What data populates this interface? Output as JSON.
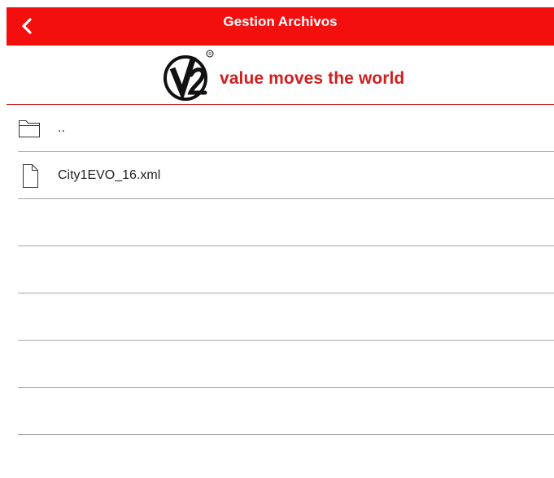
{
  "header": {
    "title": "Gestion Archivos",
    "back_icon": "chevron-left-icon",
    "background": "#f40f0f"
  },
  "brand": {
    "logo_text": "V2",
    "registered_mark": "®",
    "tagline": "value moves the world",
    "color": "#d01f1f"
  },
  "files": [
    {
      "name": "..",
      "type": "folder",
      "icon": "folder-icon"
    },
    {
      "name": "City1EVO_16.xml",
      "type": "file",
      "icon": "document-icon"
    }
  ],
  "empty_rows": 5
}
